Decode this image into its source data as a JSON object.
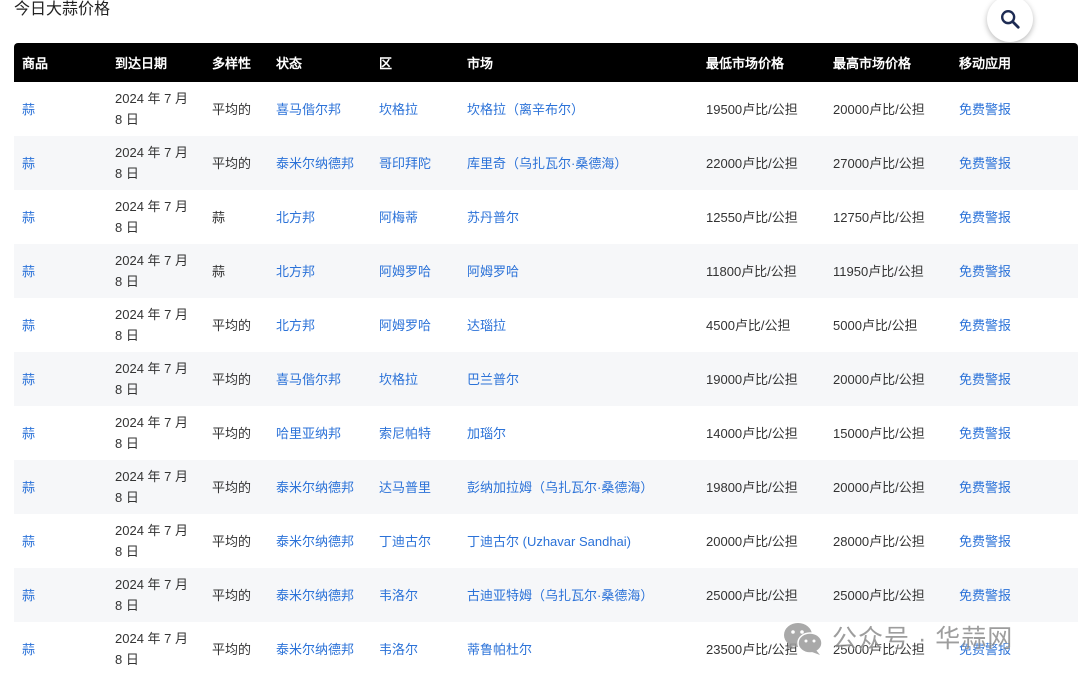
{
  "page_title": "今日大蒜价格",
  "search": {
    "icon": "search-icon"
  },
  "colors": {
    "link": "#2b72d8",
    "header_bg": "#000000",
    "header_text": "#ffffff",
    "text": "#333333",
    "stripe": "#f6f7f9"
  },
  "table": {
    "columns": [
      "商品",
      "到达日期",
      "多样性",
      "状态",
      "区",
      "市场",
      "最低市场价格",
      "最高市场价格",
      "移动应用"
    ],
    "rows": [
      {
        "commodity": "蒜",
        "date": "2024 年 7 月 8 日",
        "variety": "平均的",
        "state": "喜马偕尔邦",
        "district": "坎格拉",
        "market": "坎格拉（离辛布尔）",
        "min_price": "19500卢比/公担",
        "max_price": "20000卢比/公担",
        "app": "免费警报"
      },
      {
        "commodity": "蒜",
        "date": "2024 年 7 月 8 日",
        "variety": "平均的",
        "state": "泰米尔纳德邦",
        "district": "哥印拜陀",
        "market": "库里奇（乌扎瓦尔·桑德海）",
        "min_price": "22000卢比/公担",
        "max_price": "27000卢比/公担",
        "app": "免费警报"
      },
      {
        "commodity": "蒜",
        "date": "2024 年 7 月 8 日",
        "variety": "蒜",
        "state": "北方邦",
        "district": "阿梅蒂",
        "market": "苏丹普尔",
        "min_price": "12550卢比/公担",
        "max_price": "12750卢比/公担",
        "app": "免费警报"
      },
      {
        "commodity": "蒜",
        "date": "2024 年 7 月 8 日",
        "variety": "蒜",
        "state": "北方邦",
        "district": "阿姆罗哈",
        "market": "阿姆罗哈",
        "min_price": "11800卢比/公担",
        "max_price": "11950卢比/公担",
        "app": "免费警报"
      },
      {
        "commodity": "蒜",
        "date": "2024 年 7 月 8 日",
        "variety": "平均的",
        "state": "北方邦",
        "district": "阿姆罗哈",
        "market": "达瑙拉",
        "min_price": "4500卢比/公担",
        "max_price": "5000卢比/公担",
        "app": "免费警报"
      },
      {
        "commodity": "蒜",
        "date": "2024 年 7 月 8 日",
        "variety": "平均的",
        "state": "喜马偕尔邦",
        "district": "坎格拉",
        "market": "巴兰普尔",
        "min_price": "19000卢比/公担",
        "max_price": "20000卢比/公担",
        "app": "免费警报"
      },
      {
        "commodity": "蒜",
        "date": "2024 年 7 月 8 日",
        "variety": "平均的",
        "state": "哈里亚纳邦",
        "district": "索尼帕特",
        "market": "加瑙尔",
        "min_price": "14000卢比/公担",
        "max_price": "15000卢比/公担",
        "app": "免费警报"
      },
      {
        "commodity": "蒜",
        "date": "2024 年 7 月 8 日",
        "variety": "平均的",
        "state": "泰米尔纳德邦",
        "district": "达马普里",
        "market": "彭纳加拉姆（乌扎瓦尔·桑德海）",
        "min_price": "19800卢比/公担",
        "max_price": "20000卢比/公担",
        "app": "免费警报"
      },
      {
        "commodity": "蒜",
        "date": "2024 年 7 月 8 日",
        "variety": "平均的",
        "state": "泰米尔纳德邦",
        "district": "丁迪古尔",
        "market": "丁迪古尔 (Uzhavar Sandhai)",
        "min_price": "20000卢比/公担",
        "max_price": "28000卢比/公担",
        "app": "免费警报"
      },
      {
        "commodity": "蒜",
        "date": "2024 年 7 月 8 日",
        "variety": "平均的",
        "state": "泰米尔纳德邦",
        "district": "韦洛尔",
        "market": "古迪亚特姆（乌扎瓦尔·桑德海）",
        "min_price": "25000卢比/公担",
        "max_price": "25000卢比/公担",
        "app": "免费警报"
      },
      {
        "commodity": "蒜",
        "date": "2024 年 7 月 8 日",
        "variety": "平均的",
        "state": "泰米尔纳德邦",
        "district": "韦洛尔",
        "market": "蒂鲁帕杜尔",
        "min_price": "23500卢比/公担",
        "max_price": "25000卢比/公担",
        "app": "免费警报"
      }
    ]
  },
  "watermark": {
    "icon": "wechat-icon",
    "text": "公众号 · 华蒜网"
  }
}
